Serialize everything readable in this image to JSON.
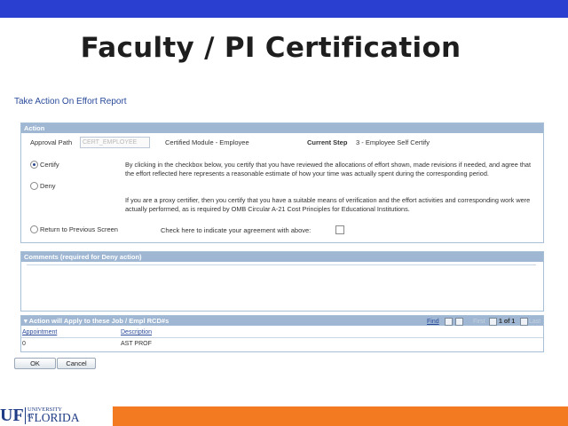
{
  "slide": {
    "title": "Faculty / PI Certification"
  },
  "page": {
    "heading": "Take Action On Effort Report"
  },
  "action": {
    "header": "Action",
    "approval_path_label": "Approval Path",
    "approval_path_value": "CERT_EMPLOYEE",
    "module": "Certified Module - Employee",
    "current_step_label": "Current Step",
    "current_step_value": "3 - Employee Self Certify",
    "options": {
      "certify": "Certify",
      "deny": "Deny",
      "return": "Return to Previous Screen",
      "selected": "certify"
    },
    "statement_1": "By clicking in the checkbox below, you certify that you have reviewed the allocations of effort shown, made revisions if needed, and agree that the effort reflected here represents a reasonable estimate of how your time was actually spent during the corresponding period.",
    "statement_2": "If you are a proxy certifier, then you certify that you have a suitable means of verification  and the effort activities and corresponding work were actually performed, as is required by OMB Circular A-21 Cost Principles for Educational Institutions.",
    "agreement_label": "Check here to indicate your agreement with above:",
    "agreement_checked": false
  },
  "comments": {
    "header": "Comments (required for Deny action)",
    "value": ""
  },
  "jobs": {
    "header": "Action will Apply to these Job / Empl RCD#s",
    "nav": {
      "find": "Find",
      "first": "First",
      "range": "1 of 1",
      "last": "Last"
    },
    "columns": [
      "Appointment",
      "Description"
    ],
    "rows": [
      {
        "appointment": "0",
        "description": "AST PROF"
      }
    ]
  },
  "buttons": {
    "ok": "OK",
    "cancel": "Cancel"
  },
  "footer": {
    "logo_short": "UF",
    "logo_university": "UNIVERSITY of",
    "logo_florida": "FLORIDA",
    "bar_color": "#f47a22",
    "top_band_color": "#2a3fd0"
  }
}
